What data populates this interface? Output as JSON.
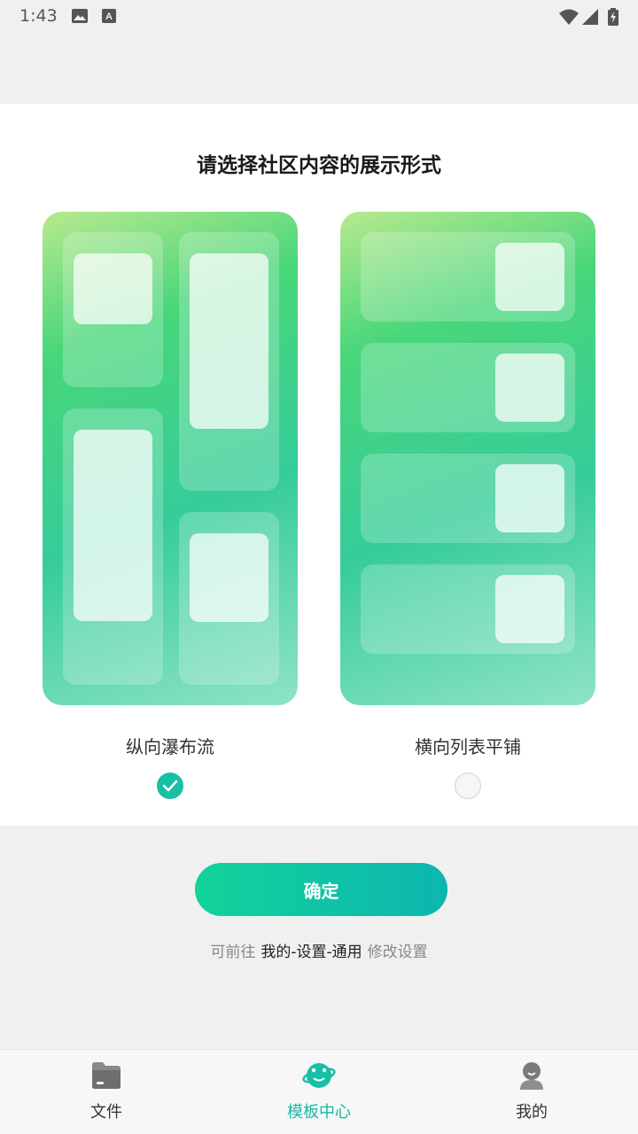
{
  "status_bar": {
    "time": "1:43",
    "icons": [
      "image-icon",
      "font-icon",
      "wifi-icon",
      "signal-icon",
      "battery-charging-icon"
    ]
  },
  "dialog": {
    "title": "请选择社区内容的展示形式",
    "options": [
      {
        "label": "纵向瀑布流",
        "selected": true,
        "preview": "waterfall-preview"
      },
      {
        "label": "横向列表平铺",
        "selected": false,
        "preview": "list-preview"
      }
    ]
  },
  "confirm_label": "确定",
  "hint": {
    "prefix": "可前往",
    "path": "我的-设置-通用",
    "suffix": "修改设置"
  },
  "tabs": [
    {
      "label": "文件",
      "icon": "folder-icon",
      "active": false
    },
    {
      "label": "模板中心",
      "icon": "planet-icon",
      "active": true
    },
    {
      "label": "我的",
      "icon": "user-icon",
      "active": false
    }
  ],
  "colors": {
    "accent": "#17bfa5",
    "button_gradient_start": "#12d39a",
    "button_gradient_end": "#0cb6b0",
    "card_gradient_light": "#b8e98e",
    "card_gradient_mid": "#48d67a"
  }
}
